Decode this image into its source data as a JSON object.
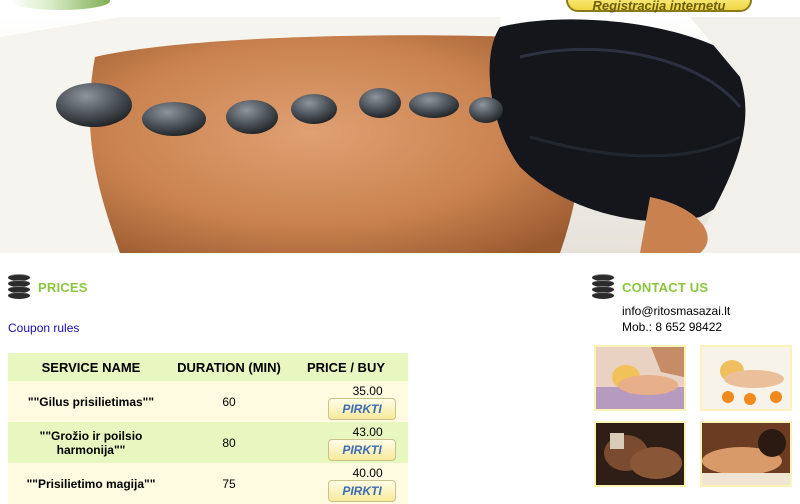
{
  "header": {
    "registration_button": "Registracija internetu"
  },
  "hero": {
    "image": "hot-stone-massage-photo"
  },
  "prices": {
    "title": "PRICES",
    "coupon_link": "Coupon rules",
    "columns": [
      "SERVICE NAME",
      "DURATION (MIN)",
      "PRICE / BUY"
    ],
    "rows": [
      {
        "service": "\"\"Gilus prisilietimas\"\"",
        "duration": "60",
        "price": "35.00",
        "buy_label": "PIRKTI"
      },
      {
        "service": "\"\"Grožio ir poilsio harmonija\"\"",
        "duration": "80",
        "price": "43.00",
        "buy_label": "PIRKTI"
      },
      {
        "service": "\"\"Prisilietimo magija\"\"",
        "duration": "75",
        "price": "40.00",
        "buy_label": "PIRKTI"
      }
    ]
  },
  "contact": {
    "title": "CONTACT US",
    "email": "info@ritosmasazai.lt",
    "phone": "Mob.: 8 652 98422"
  },
  "colors": {
    "accent_green": "#8cc63f",
    "table_header_bg": "#e8f7c0",
    "row_light_bg": "#fffbe0",
    "button_text": "#3d6bb6"
  }
}
